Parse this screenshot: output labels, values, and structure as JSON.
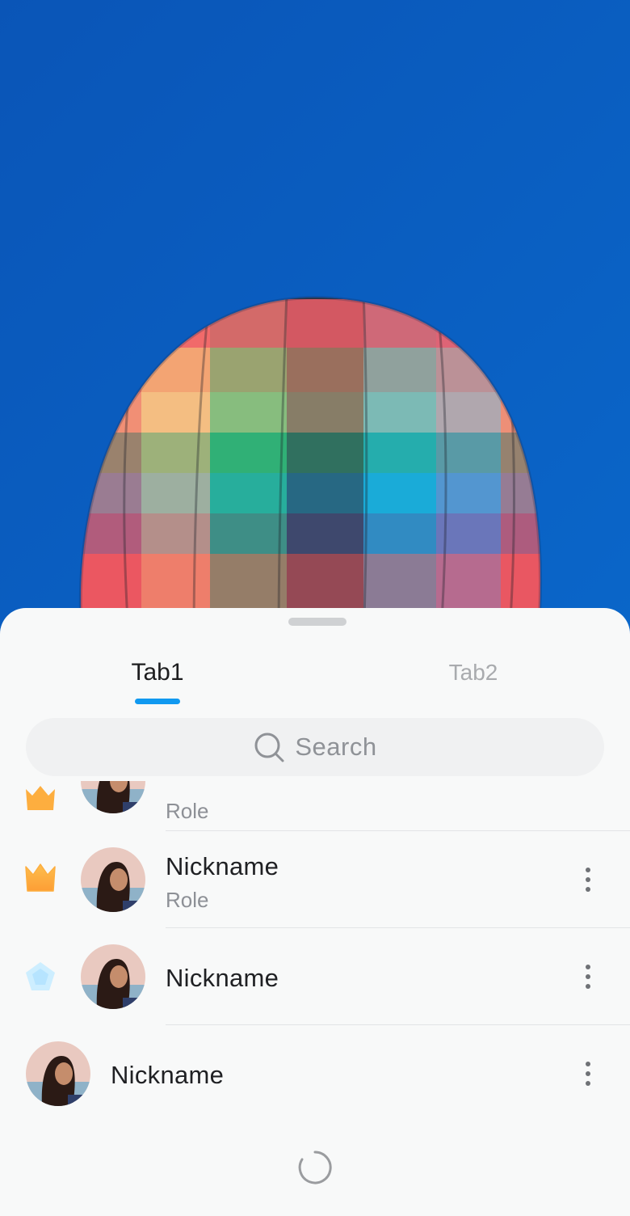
{
  "tabs": [
    {
      "label": "Tab1",
      "selected": true
    },
    {
      "label": "Tab2",
      "selected": false
    }
  ],
  "accent_color": "#1199f0",
  "search": {
    "placeholder": "Search",
    "icon": "search-icon"
  },
  "members": [
    {
      "nickname": "",
      "role": "Role",
      "badge": "crown-icon"
    },
    {
      "nickname": "Nickname",
      "role": "Role",
      "badge": "crown-icon"
    },
    {
      "nickname": "Nickname",
      "role": "",
      "badge": "diamond-icon"
    },
    {
      "nickname": "Nickname",
      "role": "",
      "badge": ""
    }
  ],
  "loading": true
}
